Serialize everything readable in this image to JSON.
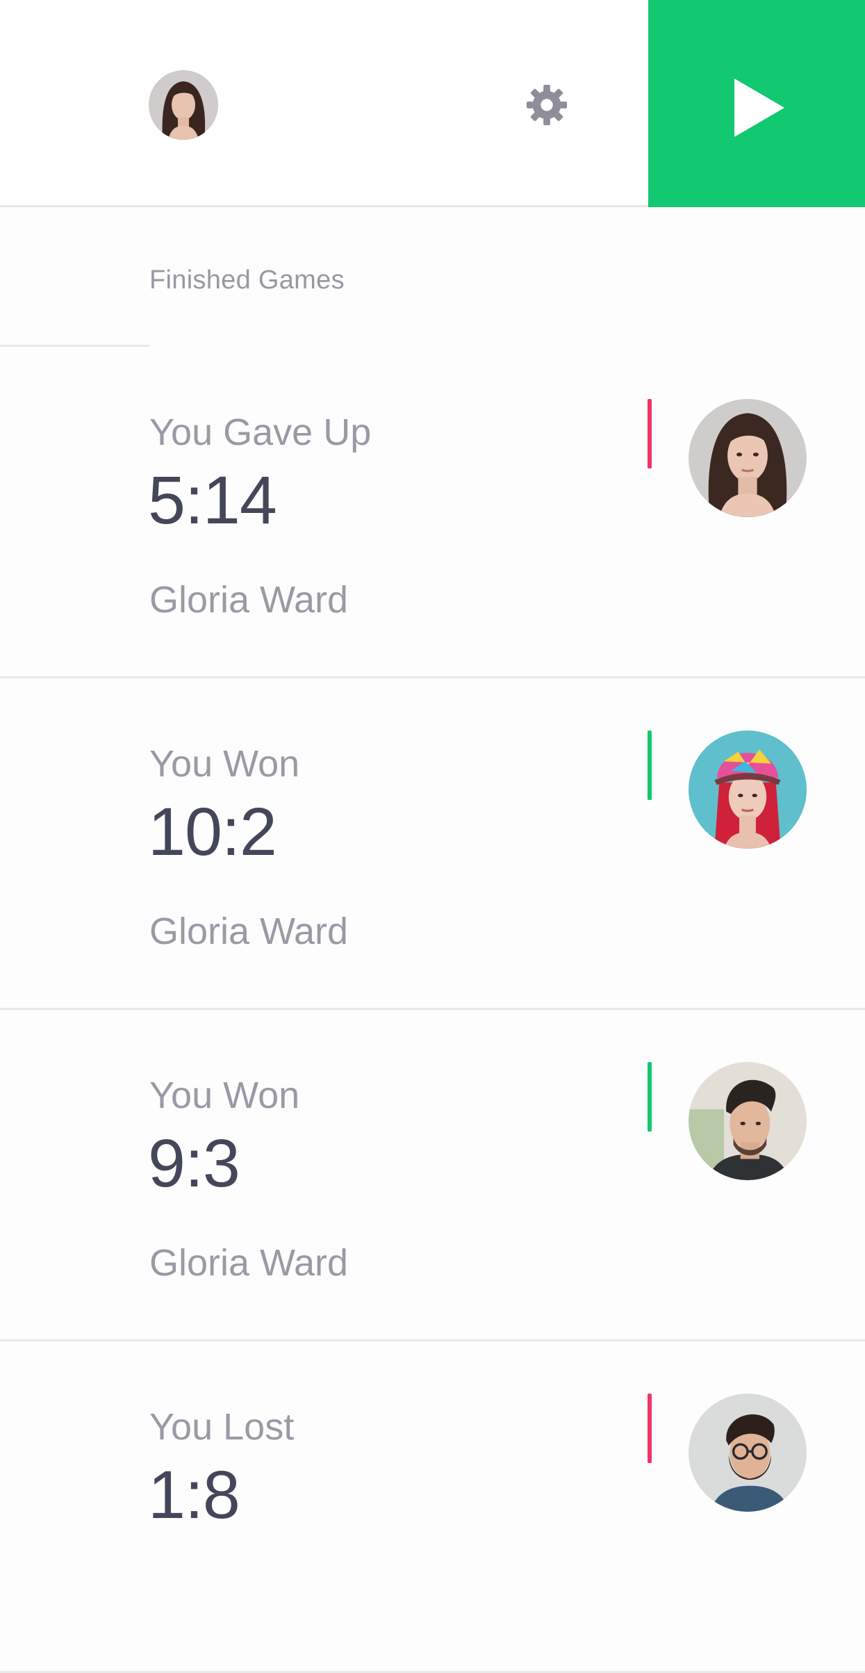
{
  "header": {
    "avatar_icon": "user-avatar",
    "settings_icon": "gear-icon",
    "play_icon": "play-icon",
    "play_color": "#12c870"
  },
  "section": {
    "title": "Finished Games"
  },
  "colors": {
    "win": "#12c870",
    "loss": "#f0336a"
  },
  "games": [
    {
      "status": "You Gave Up",
      "score": "5:14",
      "opponent": "Gloria Ward",
      "result": "loss",
      "avatar": "woman-dark-hair"
    },
    {
      "status": "You Won",
      "score": "10:2",
      "opponent": "Gloria Ward",
      "result": "win",
      "avatar": "woman-red-hair-cap"
    },
    {
      "status": "You Won",
      "score": "9:3",
      "opponent": "Gloria Ward",
      "result": "win",
      "avatar": "man-quiff"
    },
    {
      "status": "You Lost",
      "score": "1:8",
      "opponent": "",
      "result": "loss",
      "avatar": "man-beard-glasses"
    }
  ]
}
